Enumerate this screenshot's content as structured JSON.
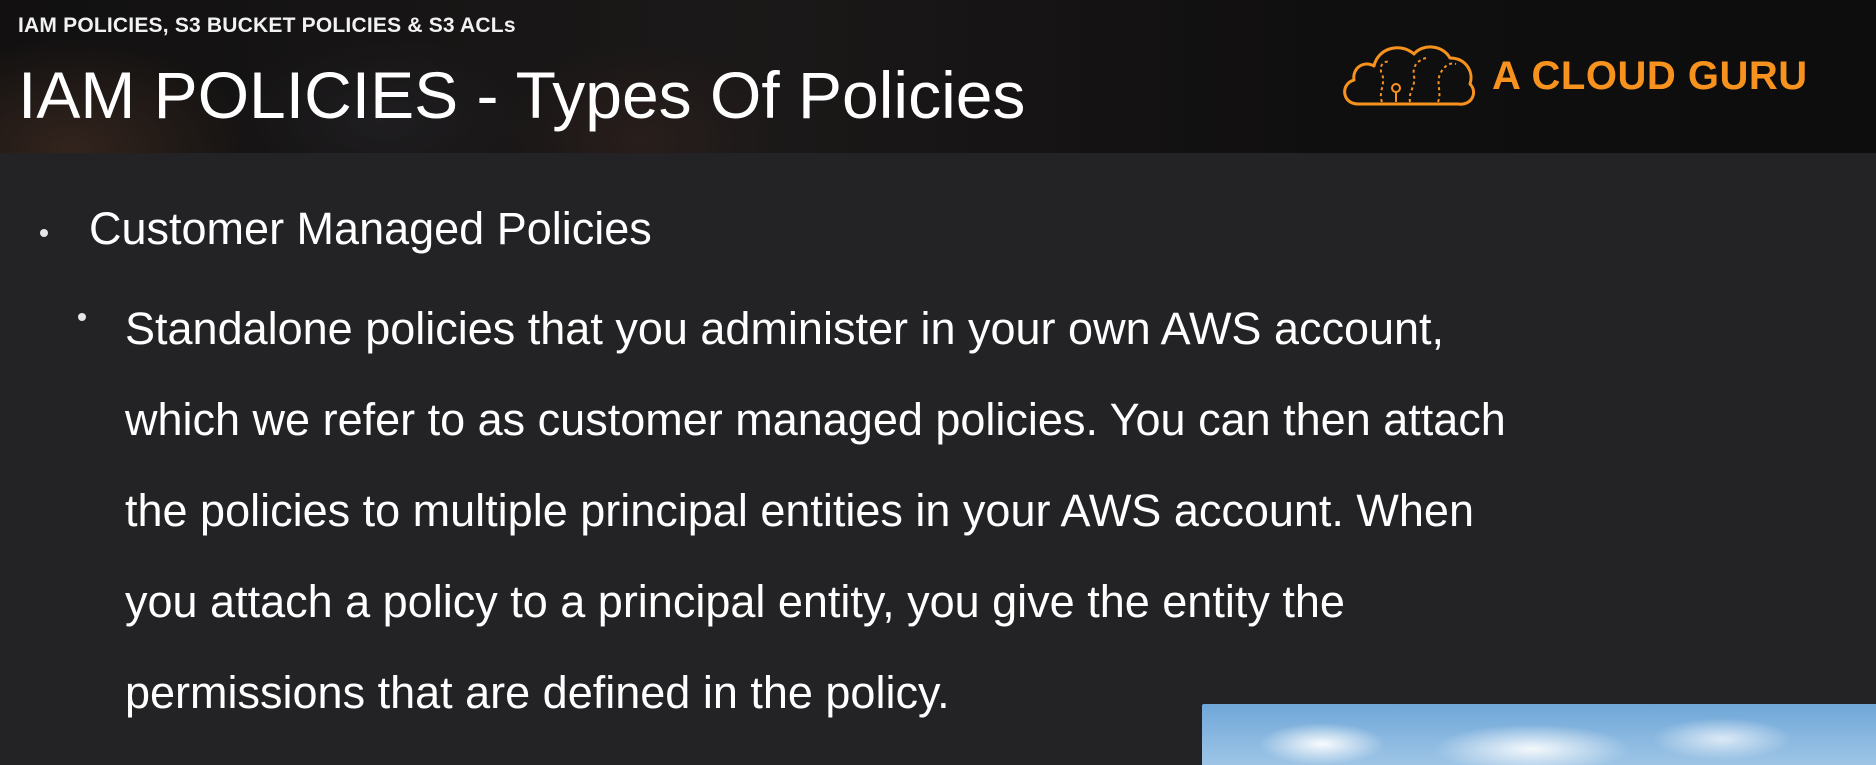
{
  "header": {
    "breadcrumb": "IAM POLICIES, S3 BUCKET POLICIES & S3 ACLs",
    "title": "IAM POLICIES - Types Of Policies",
    "brand": {
      "name": "A CLOUD GURU",
      "color": "#f7921e"
    }
  },
  "content": {
    "bullets": [
      {
        "text": "Customer Managed Policies",
        "children": [
          {
            "lines": [
              "Standalone policies that you administer in your own AWS account,",
              "which we refer to as customer managed policies. You can then attach",
              "the policies to multiple principal entities in your AWS account. When",
              "you attach a policy to a principal entity, you give the entity the",
              "permissions that are defined in the policy."
            ]
          }
        ]
      }
    ]
  },
  "colors": {
    "background": "#232325",
    "text": "#ffffff",
    "accent": "#f7921e"
  },
  "icons": {
    "brand_logo": "cloud-logo-icon"
  }
}
